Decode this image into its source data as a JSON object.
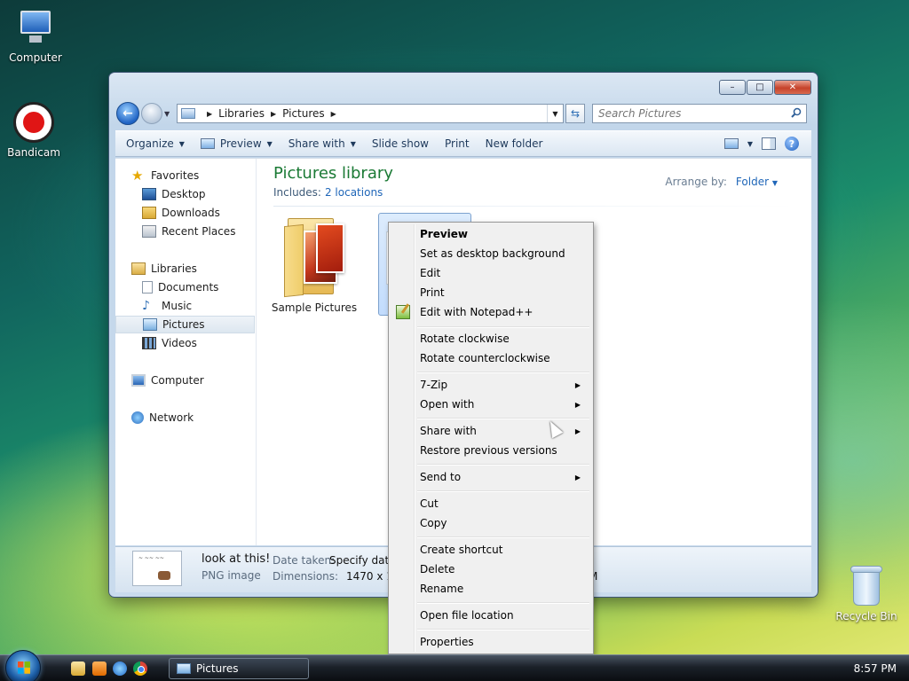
{
  "desktop": {
    "icons": [
      {
        "label": "Computer"
      },
      {
        "label": "Bandicam"
      },
      {
        "label": "Recycle Bin"
      }
    ]
  },
  "window": {
    "address": {
      "crumbs": [
        "Libraries",
        "Pictures"
      ]
    },
    "search": {
      "placeholder": "Search Pictures"
    },
    "toolbar": {
      "organize": "Organize",
      "preview": "Preview",
      "share_with": "Share with",
      "slide_show": "Slide show",
      "print": "Print",
      "new_folder": "New folder"
    },
    "nav": {
      "favorites": "Favorites",
      "desktop": "Desktop",
      "downloads": "Downloads",
      "recent_places": "Recent Places",
      "libraries": "Libraries",
      "documents": "Documents",
      "music": "Music",
      "pictures": "Pictures",
      "videos": "Videos",
      "computer": "Computer",
      "network": "Network"
    },
    "library": {
      "title": "Pictures library",
      "includes_label": "Includes:",
      "includes_link": "2 locations",
      "arrange_label": "Arrange by:",
      "arrange_value": "Folder"
    },
    "items": [
      {
        "name": "Sample Pictures"
      }
    ],
    "details": {
      "name": "look at this!",
      "type": "PNG image",
      "date_label": "Date taken:",
      "date_value": "Specify date",
      "dim_label": "Dimensions:",
      "dim_value": "1470 x 1036",
      "clipped": "M"
    }
  },
  "context_menu": {
    "preview": "Preview",
    "set_background": "Set as desktop background",
    "edit": "Edit",
    "print": "Print",
    "edit_notepad": "Edit with Notepad++",
    "rotate_cw": "Rotate clockwise",
    "rotate_ccw": "Rotate counterclockwise",
    "seven_zip": "7-Zip",
    "open_with": "Open with",
    "share_with": "Share with",
    "restore": "Restore previous versions",
    "send_to": "Send to",
    "cut": "Cut",
    "copy": "Copy",
    "create_shortcut": "Create shortcut",
    "delete": "Delete",
    "rename": "Rename",
    "open_location": "Open file location",
    "properties": "Properties"
  },
  "taskbar": {
    "task_label": "Pictures",
    "clock": "8:57 PM"
  }
}
